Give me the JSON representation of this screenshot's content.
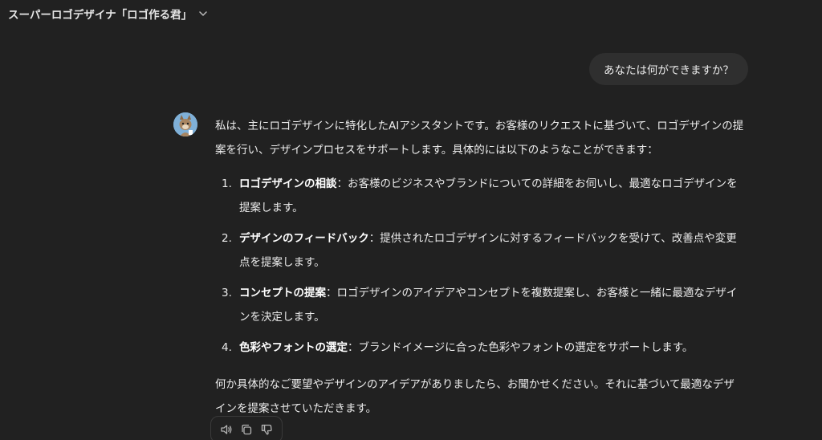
{
  "header": {
    "title": "スーパーロゴデザイナ「ロゴ作る君」"
  },
  "conversation": {
    "user_message": "あなたは何ができますか？",
    "assistant": {
      "intro": "私は、主にロゴデザインに特化したAIアシスタントです。お客様のリクエストに基づいて、ロゴデザインの提案を行い、デザインプロセスをサポートします。具体的には以下のようなことができます：",
      "items": [
        {
          "num": "1.",
          "title": "ロゴデザインの相談",
          "text": "：お客様のビジネスやブランドについての詳細をお伺いし、最適なロゴデザインを提案します。"
        },
        {
          "num": "2.",
          "title": "デザインのフィードバック",
          "text": "：提供されたロゴデザインに対するフィードバックを受けて、改善点や変更点を提案します。"
        },
        {
          "num": "3.",
          "title": "コンセプトの提案",
          "text": "：ロゴデザインのアイデアやコンセプトを複数提案し、お客様と一緒に最適なデザインを決定します。"
        },
        {
          "num": "4.",
          "title": "色彩やフォントの選定",
          "text": "：ブランドイメージに合った色彩やフォントの選定をサポートします。"
        }
      ],
      "outro": "何か具体的なご要望やデザインのアイデアがありましたら、お聞かせください。それに基づいて最適なデザインを提案させていただきます。"
    }
  },
  "icons": {
    "header_dropdown": "chevron-down-icon",
    "avatar": "assistant-avatar",
    "read_aloud": "speaker-icon",
    "copy": "copy-icon",
    "dislike": "thumbs-down-icon"
  },
  "colors": {
    "background": "#212121",
    "user_bubble": "#2f2f2f",
    "text": "#ececec",
    "avatar_bg": "#7fb0d8"
  }
}
